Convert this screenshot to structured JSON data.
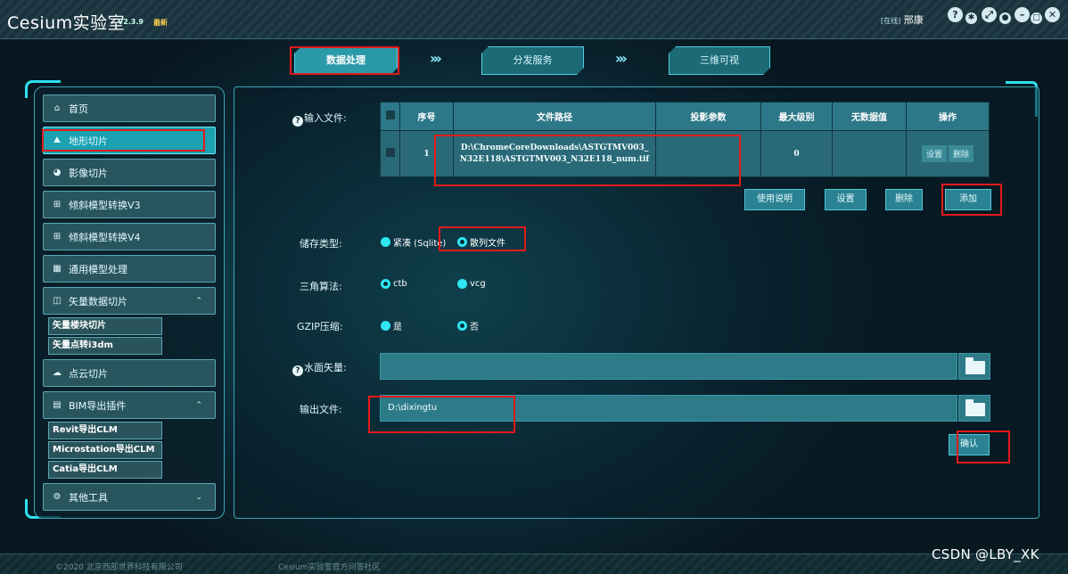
{
  "app": {
    "title": "Cesium实验室",
    "version": "V2.3.9",
    "update_badge": "最新",
    "user_status": "[在线]",
    "user_name": "邢康",
    "window_controls": [
      "help-icon",
      "settings-icon",
      "expand-icon",
      "user-icon",
      "minimize-icon",
      "close-icon"
    ]
  },
  "steps": [
    {
      "label": "数据处理",
      "active": true
    },
    {
      "label": "分发服务",
      "active": false
    },
    {
      "label": "三维可视",
      "active": false
    }
  ],
  "step_arrow": "›››",
  "sidebar": {
    "items": [
      {
        "label": "首页",
        "icon": "home-icon",
        "glyph": "⌂"
      },
      {
        "label": "地形切片",
        "icon": "terrain-icon",
        "glyph": "⛰",
        "selected": true
      },
      {
        "label": "影像切片",
        "icon": "globe-icon",
        "glyph": "◕"
      },
      {
        "label": "倾斜模型转换V3",
        "icon": "oblique-model-icon",
        "glyph": "⊞"
      },
      {
        "label": "倾斜模型转换V4",
        "icon": "oblique-model-icon",
        "glyph": "⊞"
      },
      {
        "label": "通用模型处理",
        "icon": "model-icon",
        "glyph": "▦"
      },
      {
        "label": "矢量数据切片",
        "icon": "vector-icon",
        "glyph": "◫",
        "expand": "⌃"
      },
      {
        "label": "点云切片",
        "icon": "pointcloud-icon",
        "glyph": "☁"
      },
      {
        "label": "BIM导出插件",
        "icon": "bim-icon",
        "glyph": "▤",
        "expand": "⌃"
      },
      {
        "label": "其他工具",
        "icon": "tools-icon",
        "glyph": "⚙",
        "expand": "⌄"
      }
    ],
    "vector_sub": [
      "矢量楼块切片",
      "矢量点转i3dm"
    ],
    "bim_sub": [
      "Revit导出CLM",
      "Microstation导出CLM",
      "Catia导出CLM"
    ]
  },
  "form": {
    "input_label": "输入文件:",
    "table": {
      "headers": [
        "",
        "序号",
        "文件路径",
        "投影参数",
        "最大级别",
        "无数据值",
        "操作"
      ],
      "rows": [
        {
          "index": "1",
          "path": "D:\\ChromeCoreDownloads\\ASTGTMV003_N32E118\\ASTGTMV003_N32E118_num.tif",
          "projection": "",
          "max_level": "0",
          "nodata": "",
          "ops": [
            "设置",
            "删除"
          ]
        }
      ]
    },
    "actions": [
      "使用说明",
      "设置",
      "删除",
      "添加"
    ],
    "storage_label": "储存类型:",
    "storage_options": [
      {
        "label": "紧凑 (Sqlite)",
        "checked": false
      },
      {
        "label": "散列文件",
        "checked": true
      }
    ],
    "algo_label": "三角算法:",
    "algo_options": [
      {
        "label": "ctb",
        "checked": true
      },
      {
        "label": "vcg",
        "checked": false
      }
    ],
    "gzip_label": "GZIP压缩:",
    "gzip_options": [
      {
        "label": "是",
        "checked": false
      },
      {
        "label": "否",
        "checked": true
      }
    ],
    "water_label": "水面矢量:",
    "water_value": "",
    "output_label": "输出文件:",
    "output_value": "D:\\dixingtu",
    "confirm": "确认"
  },
  "footer": {
    "copyright": "©2020 北京西部世界科技有限公司",
    "community": "Cesium实验室官方问答社区"
  },
  "watermark": "CSDN @LBY_XK"
}
